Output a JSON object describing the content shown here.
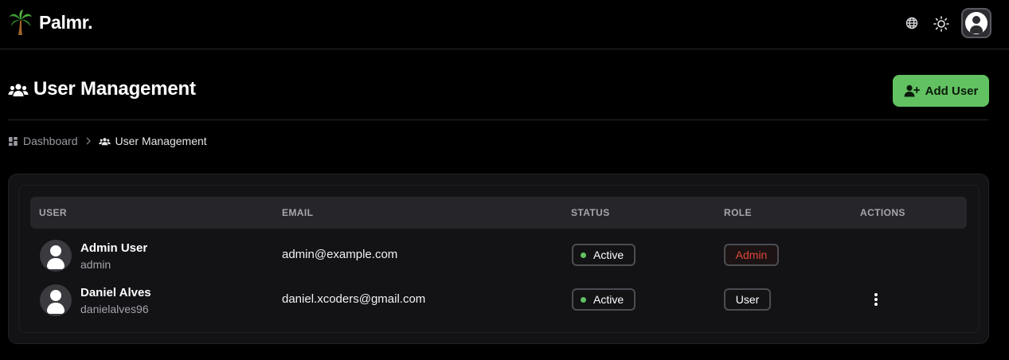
{
  "app": {
    "name": "Palmr.",
    "logo_icon": "palm-tree-icon",
    "header_icons": [
      "globe-icon",
      "sun-icon",
      "user-icon"
    ]
  },
  "page": {
    "title": "User Management",
    "title_icon": "users-icon",
    "add_button_label": "Add User"
  },
  "breadcrumb": {
    "dashboard_label": "Dashboard",
    "current_label": "User Management"
  },
  "table": {
    "columns": [
      "USER",
      "EMAIL",
      "STATUS",
      "ROLE",
      "ACTIONS"
    ],
    "rows": [
      {
        "name": "Admin User",
        "username": "admin",
        "email": "admin@example.com",
        "status": "Active",
        "role": "Admin",
        "has_actions": false
      },
      {
        "name": "Daniel Alves",
        "username": "danielalves96",
        "email": "daniel.xcoders@gmail.com",
        "status": "Active",
        "role": "User",
        "has_actions": true
      }
    ]
  },
  "colors": {
    "accent": "#62c161",
    "admin_role": "#e0473a",
    "background": "#000000",
    "card": "#131316"
  }
}
